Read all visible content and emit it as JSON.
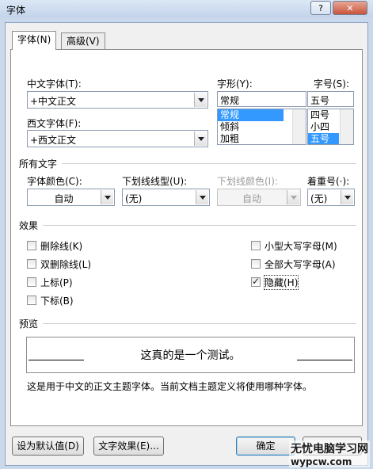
{
  "window": {
    "title": "字体",
    "help": "?",
    "close": "✕"
  },
  "tabs": [
    {
      "label": "字体(N)"
    },
    {
      "label": "高级(V)"
    }
  ],
  "font": {
    "chinese_label": "中文字体(T):",
    "chinese_value": "+中文正文",
    "western_label": "西文字体(F):",
    "western_value": "+西文正文",
    "style_label": "字形(Y):",
    "style_value": "常规",
    "style_options": [
      "常规",
      "倾斜",
      "加粗"
    ],
    "style_selected": "常规",
    "size_label": "字号(S):",
    "size_value": "五号",
    "size_options": [
      "四号",
      "小四",
      "五号"
    ],
    "size_selected": "五号"
  },
  "all_text": {
    "heading": "所有文字",
    "color_label": "字体颜色(C):",
    "color_value": "自动",
    "underline_label": "下划线线型(U):",
    "underline_value": "(无)",
    "underline_color_label": "下划线颜色(I):",
    "underline_color_value": "自动",
    "emphasis_label": "着重号(·):",
    "emphasis_value": "(无)"
  },
  "effects": {
    "heading": "效果",
    "left": [
      {
        "label": "删除线(K)",
        "checked": false
      },
      {
        "label": "双删除线(L)",
        "checked": false
      },
      {
        "label": "上标(P)",
        "checked": false
      },
      {
        "label": "下标(B)",
        "checked": false
      }
    ],
    "right": [
      {
        "label": "小型大写字母(M)",
        "checked": false
      },
      {
        "label": "全部大写字母(A)",
        "checked": false
      },
      {
        "label": "隐藏(H)",
        "checked": true
      }
    ]
  },
  "preview": {
    "heading": "预览",
    "sample": "这真的是一个测试。",
    "note": "这是用于中文的正文主题字体。当前文档主题定义将使用哪种字体。"
  },
  "buttons": {
    "set_default": "设为默认值(D)",
    "text_effects": "文字效果(E)...",
    "ok": "确定"
  },
  "watermark": {
    "text": "无忧电脑学习网",
    "url": "wypcw.com"
  }
}
